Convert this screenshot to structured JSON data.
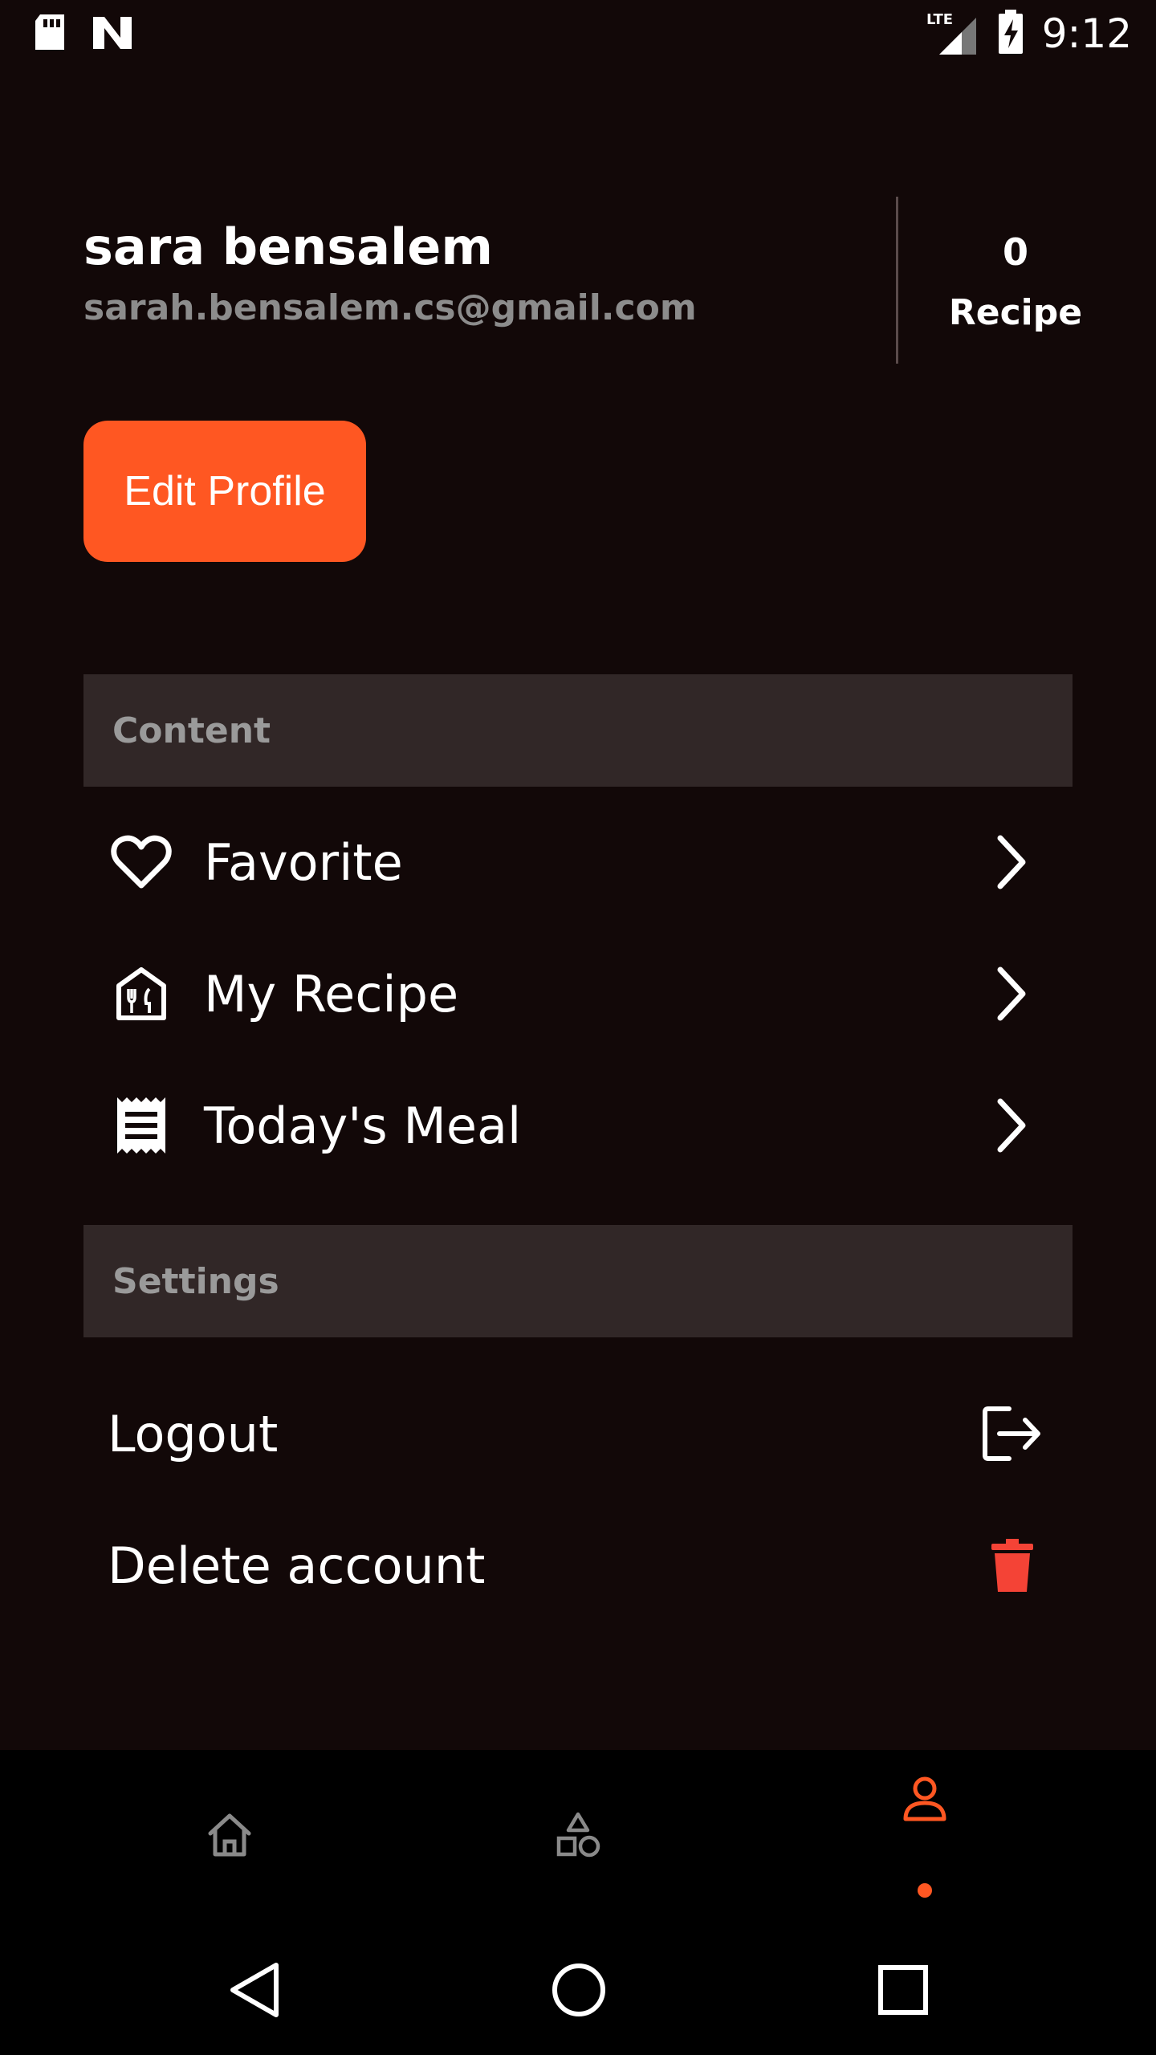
{
  "status_bar": {
    "time": "9:12",
    "network": "LTE",
    "icons": [
      "sd-card-icon",
      "n-logo-icon",
      "lte-signal-icon",
      "battery-charging-icon"
    ]
  },
  "profile": {
    "name": "sara bensalem",
    "email": "sarah.bensalem.cs@gmail.com",
    "recipe_count": "0",
    "recipe_label": "Recipe",
    "edit_button": "Edit Profile"
  },
  "content_section": {
    "title": "Content",
    "items": [
      {
        "label": "Favorite",
        "icon": "heart-icon"
      },
      {
        "label": "My Recipe",
        "icon": "restaurant-icon"
      },
      {
        "label": "Today's Meal",
        "icon": "receipt-icon"
      }
    ]
  },
  "settings_section": {
    "title": "Settings",
    "items": [
      {
        "label": "Logout",
        "icon": "logout-icon"
      },
      {
        "label": "Delete account",
        "icon": "trash-icon"
      }
    ]
  },
  "bottom_nav": {
    "items": [
      {
        "name": "home",
        "icon": "home-icon",
        "active": false
      },
      {
        "name": "categories",
        "icon": "shapes-icon",
        "active": false
      },
      {
        "name": "profile",
        "icon": "person-icon",
        "active": true
      }
    ]
  },
  "colors": {
    "background": "#120808",
    "accent": "#ff5722",
    "section_header": "#312727",
    "danger": "#f44336"
  }
}
